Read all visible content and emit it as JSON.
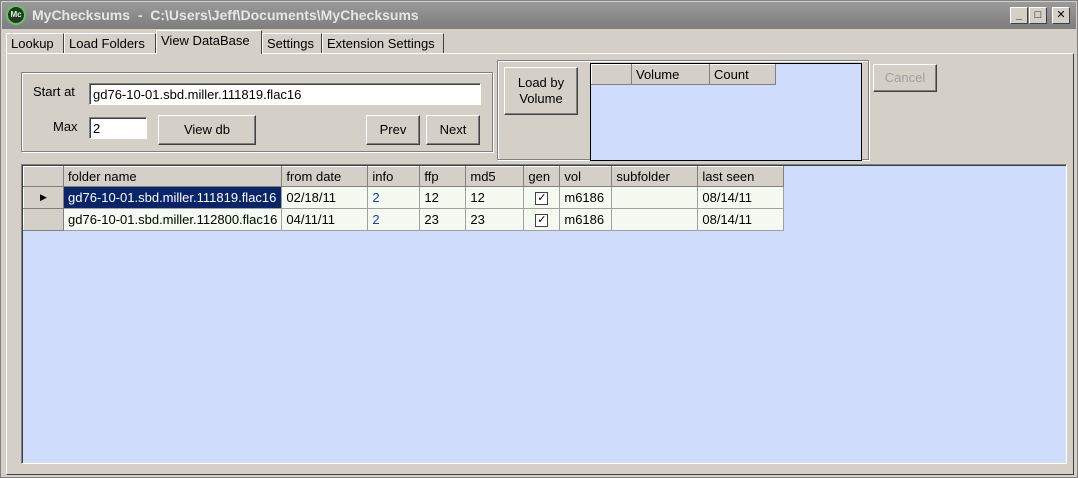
{
  "window": {
    "app_icon": "Mc",
    "title": "MyChecksums  -  C:\\Users\\Jeff\\Documents\\MyChecksums",
    "minimize": "_",
    "maximize": "□",
    "close": "✕"
  },
  "tabs": [
    {
      "label": "Lookup",
      "active": false
    },
    {
      "label": "Load Folders",
      "active": false
    },
    {
      "label": "View DataBase",
      "active": true
    },
    {
      "label": "Settings",
      "active": false
    },
    {
      "label": "Extension Settings",
      "active": false
    }
  ],
  "query": {
    "start_at_label": "Start at",
    "start_at_value": "gd76-10-01.sbd.miller.111819.flac16",
    "max_label": "Max",
    "max_value": "2",
    "view_db_label": "View db",
    "prev_label": "Prev",
    "next_label": "Next"
  },
  "volume": {
    "load_by_volume_label": "Load by Volume",
    "columns": [
      "Volume",
      "Count"
    ],
    "rows": []
  },
  "cancel_label": "Cancel",
  "grid": {
    "columns": [
      "folder name",
      "from date",
      "info",
      "ffp",
      "md5",
      "gen",
      "vol",
      "subfolder",
      "last seen"
    ],
    "current_row_marker": "▶",
    "rows": [
      {
        "folder_name": "gd76-10-01.sbd.miller.111819.flac16",
        "from_date": "02/18/11",
        "info": "2",
        "ffp": "12",
        "md5": "12",
        "gen": "✓",
        "vol": "m6186",
        "subfolder": "",
        "last_seen": "08/14/11"
      },
      {
        "folder_name": "gd76-10-01.sbd.miller.112800.flac16",
        "from_date": "04/11/11",
        "info": "2",
        "ffp": "23",
        "md5": "23",
        "gen": "✓",
        "vol": "m6186",
        "subfolder": "",
        "last_seen": "08/14/11"
      }
    ]
  }
}
